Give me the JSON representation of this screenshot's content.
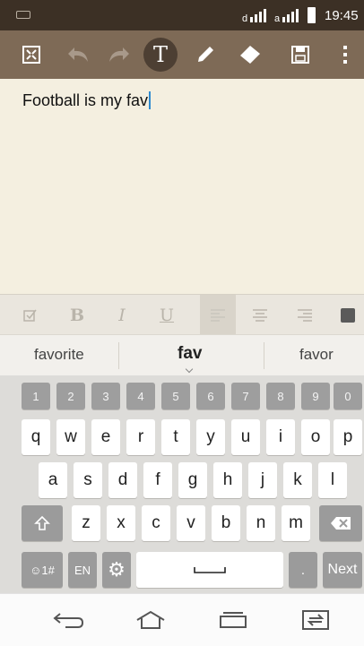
{
  "status_bar": {
    "time": "19:45",
    "notification_icon": "notification-icon",
    "signal_icons": [
      "signal-1-icon",
      "signal-2-icon"
    ],
    "battery_icon": "battery-icon"
  },
  "toolbar": {
    "buttons": [
      {
        "name": "collapse-button",
        "icon": "collapse-icon"
      },
      {
        "name": "undo-button",
        "icon": "undo-icon"
      },
      {
        "name": "redo-button",
        "icon": "redo-icon"
      },
      {
        "name": "text-mode-button",
        "icon": "text-icon",
        "label": "T",
        "active": true
      },
      {
        "name": "pen-button",
        "icon": "pen-icon"
      },
      {
        "name": "eraser-button",
        "icon": "eraser-icon"
      },
      {
        "name": "save-button",
        "icon": "save-icon"
      },
      {
        "name": "more-options-button",
        "icon": "more-vertical-icon"
      }
    ]
  },
  "note": {
    "text": "Football is my fav"
  },
  "format_bar": {
    "bold_label": "B",
    "italic_label": "I",
    "underline_label": "U",
    "icons": [
      "checkbox-icon",
      "align-left-icon",
      "align-center-icon",
      "align-right-icon",
      "color-icon"
    ],
    "selected": "align-left-icon"
  },
  "suggestions": {
    "left": "favorite",
    "center": "fav",
    "right": "favor"
  },
  "keyboard": {
    "number_row": [
      "1",
      "2",
      "3",
      "4",
      "5",
      "6",
      "7",
      "8",
      "9",
      "0"
    ],
    "row1": [
      "q",
      "w",
      "e",
      "r",
      "t",
      "y",
      "u",
      "i",
      "o",
      "p"
    ],
    "row2": [
      "a",
      "s",
      "d",
      "f",
      "g",
      "h",
      "j",
      "k",
      "l"
    ],
    "row3": [
      "z",
      "x",
      "c",
      "v",
      "b",
      "n",
      "m"
    ],
    "symbols_label": "☺1#",
    "language_label": "EN",
    "next_label": "Next",
    "period_label": ".",
    "shift_icon": "shift-icon",
    "backspace_icon": "backspace-icon",
    "settings_icon": "gear-icon",
    "space_icon": "space-icon"
  },
  "nav_bar": {
    "icons": [
      "back-icon",
      "home-icon",
      "recent-apps-icon",
      "dual-window-icon"
    ]
  },
  "colors": {
    "status_bar": "#3c3025",
    "toolbar": "#7e6a56",
    "note_background": "#f4efe0",
    "caret": "#2f8bd0",
    "number_keys": "#9e9e9e"
  }
}
